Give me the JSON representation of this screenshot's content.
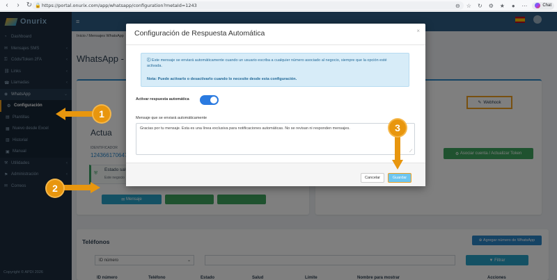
{
  "browser": {
    "url": "https://portal.onurix.com/app/whatsapp/configuration?metaId=1243",
    "chat_label": "Chat"
  },
  "app": {
    "brand": "Onurix",
    "copyright": "Copyright © APDI 2026",
    "sidebar": {
      "items": [
        {
          "label": "Dashboard",
          "icon": "dashboard-icon"
        },
        {
          "label": "Mensajes SMS",
          "icon": "sms-icon",
          "caret": "‹"
        },
        {
          "label": "Códs/Token 2FA",
          "icon": "key-icon",
          "caret": "‹"
        },
        {
          "label": "Links",
          "icon": "link-icon",
          "caret": "‹"
        },
        {
          "label": "Llamadas",
          "icon": "phone-icon",
          "caret": "‹"
        },
        {
          "label": "WhatsApp",
          "icon": "whatsapp-icon",
          "caret": "⌄"
        },
        {
          "label": "Configuración",
          "icon": "gear-icon"
        },
        {
          "label": "Plantillas",
          "icon": "template-icon"
        },
        {
          "label": "Nuevo desde Excel",
          "icon": "excel-icon"
        },
        {
          "label": "Historial",
          "icon": "history-icon"
        },
        {
          "label": "Manual",
          "icon": "manual-icon"
        },
        {
          "label": "Utilidades",
          "icon": "tools-icon",
          "caret": "‹"
        },
        {
          "label": "Administración",
          "icon": "admin-icon",
          "caret": "‹"
        },
        {
          "label": "Correos",
          "icon": "mail-icon"
        }
      ]
    },
    "breadcrumb": "Inicio / Mensajes WhatsApp",
    "page_title": "WhatsApp - C",
    "tabs": {
      "webhook": "Webhook"
    },
    "account": {
      "heading": "Actua",
      "identifier_label": "IDENTIFICADOR",
      "identifier_value": "124366170647",
      "status_title": "Estado salu",
      "status_sub": "Este negocio"
    },
    "buttons": {
      "message": "Mensaje",
      "token": "Asociar cuenta / Actualizar Token"
    },
    "phones": {
      "title": "Teléfonos",
      "add_button": "Agregar número de WhatsApp",
      "filter_select": "ID número",
      "filter_button": "Filtrar",
      "columns": [
        "ID número",
        "Teléfono",
        "Estado",
        "Salud",
        "Límite",
        "Nombre para mostrar",
        "Acciones"
      ]
    }
  },
  "modal": {
    "title": "Configuración de Respuesta Automática",
    "close": "×",
    "info_text": "Este mensaje se enviará automáticamente cuando un usuario escriba a cualquier número asociado al negocio, siempre que la opción esté activada.",
    "info_note": "Nota: Puede activarlo o desactivarlo cuando lo necesite desde esta configuración.",
    "toggle_label": "Activar respuesta automática",
    "toggle_on": true,
    "message_label": "Mensaje que se enviará automáticamente",
    "message_value": "Gracias por tu mensaje. Esta es una línea exclusiva para notificaciones automáticas. No se revisan ni responden mensajes.",
    "cancel": "Cancelar",
    "save": "Guardar"
  },
  "callouts": [
    "1",
    "2",
    "3"
  ],
  "colors": {
    "accent": "#f0a020",
    "primary": "#2a7ae0",
    "sidebar": "#1c2d3f",
    "topbar": "#2f5e86"
  }
}
